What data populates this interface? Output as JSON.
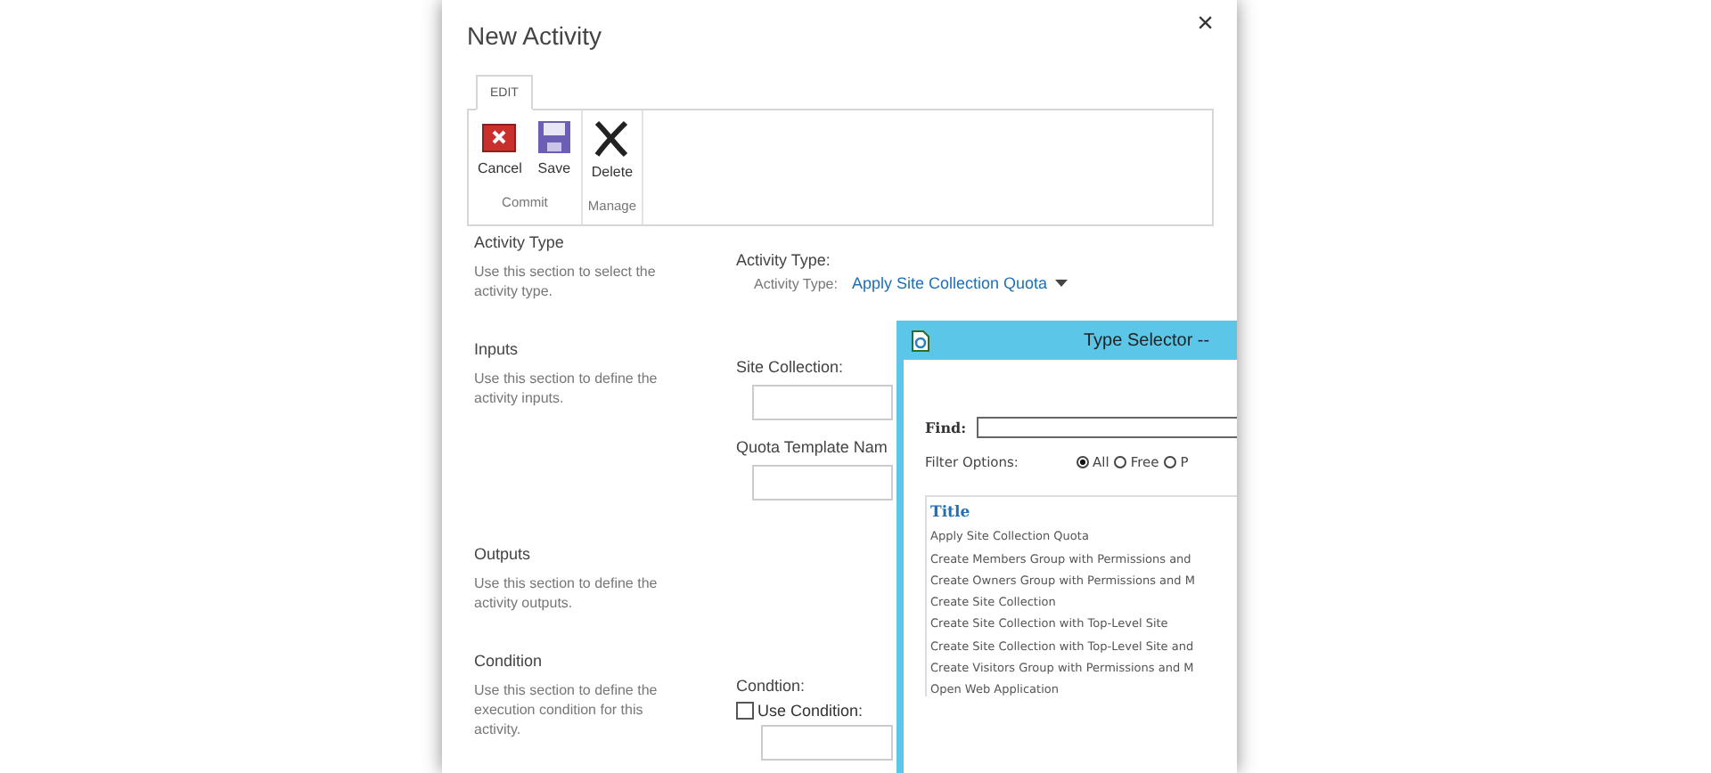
{
  "dialog": {
    "title": "New Activity",
    "close": "×"
  },
  "ribbon": {
    "tabs": [
      {
        "label": "EDIT",
        "selected": true
      }
    ],
    "groups": [
      {
        "label": "Commit",
        "buttons": [
          {
            "kind": "cancel",
            "label": "Cancel"
          },
          {
            "kind": "save",
            "label": "Save"
          }
        ]
      },
      {
        "label": "Manage",
        "buttons": [
          {
            "kind": "delete",
            "label": "Delete"
          }
        ]
      }
    ]
  },
  "sections": [
    {
      "title": "Activity Type",
      "description": "Use this section to select the activity type.",
      "fields": [
        {
          "kind": "select",
          "label": "Activity Type:",
          "sublabel": "Activity Type:",
          "value": "Apply Site Collection Quota"
        }
      ]
    },
    {
      "title": "Inputs",
      "description": "Use this section to define the activity inputs.",
      "fields": [
        {
          "kind": "text",
          "label": "Site Collection:"
        },
        {
          "kind": "text",
          "label": "Quota Template Nam"
        }
      ]
    },
    {
      "title": "Outputs",
      "description": "Use this section to define the activity outputs."
    },
    {
      "title": "Condition",
      "description": "Use this section to define the execution condition for this activity.",
      "fields": [
        {
          "kind": "checkbox",
          "label": "Condtion:",
          "checkbox_label": "Use Condition:",
          "checked": false
        }
      ]
    }
  ],
  "type_selector": {
    "title": "Type Selector --",
    "find_label": "Find:",
    "filter_label": "Filter Options:",
    "filters": [
      {
        "label": "All",
        "selected": true
      },
      {
        "label": "Free",
        "selected": false
      },
      {
        "label": "P",
        "selected": false
      }
    ],
    "column": "Title",
    "items": [
      "Apply Site Collection Quota",
      "Create Members Group with Permissions and",
      "Create Owners Group with Permissions and M",
      "Create Site Collection",
      "Create Site Collection with Top-Level Site",
      "Create Site Collection with Top-Level Site and",
      "Create Visitors Group with Permissions and M",
      "Open Web Application"
    ]
  }
}
